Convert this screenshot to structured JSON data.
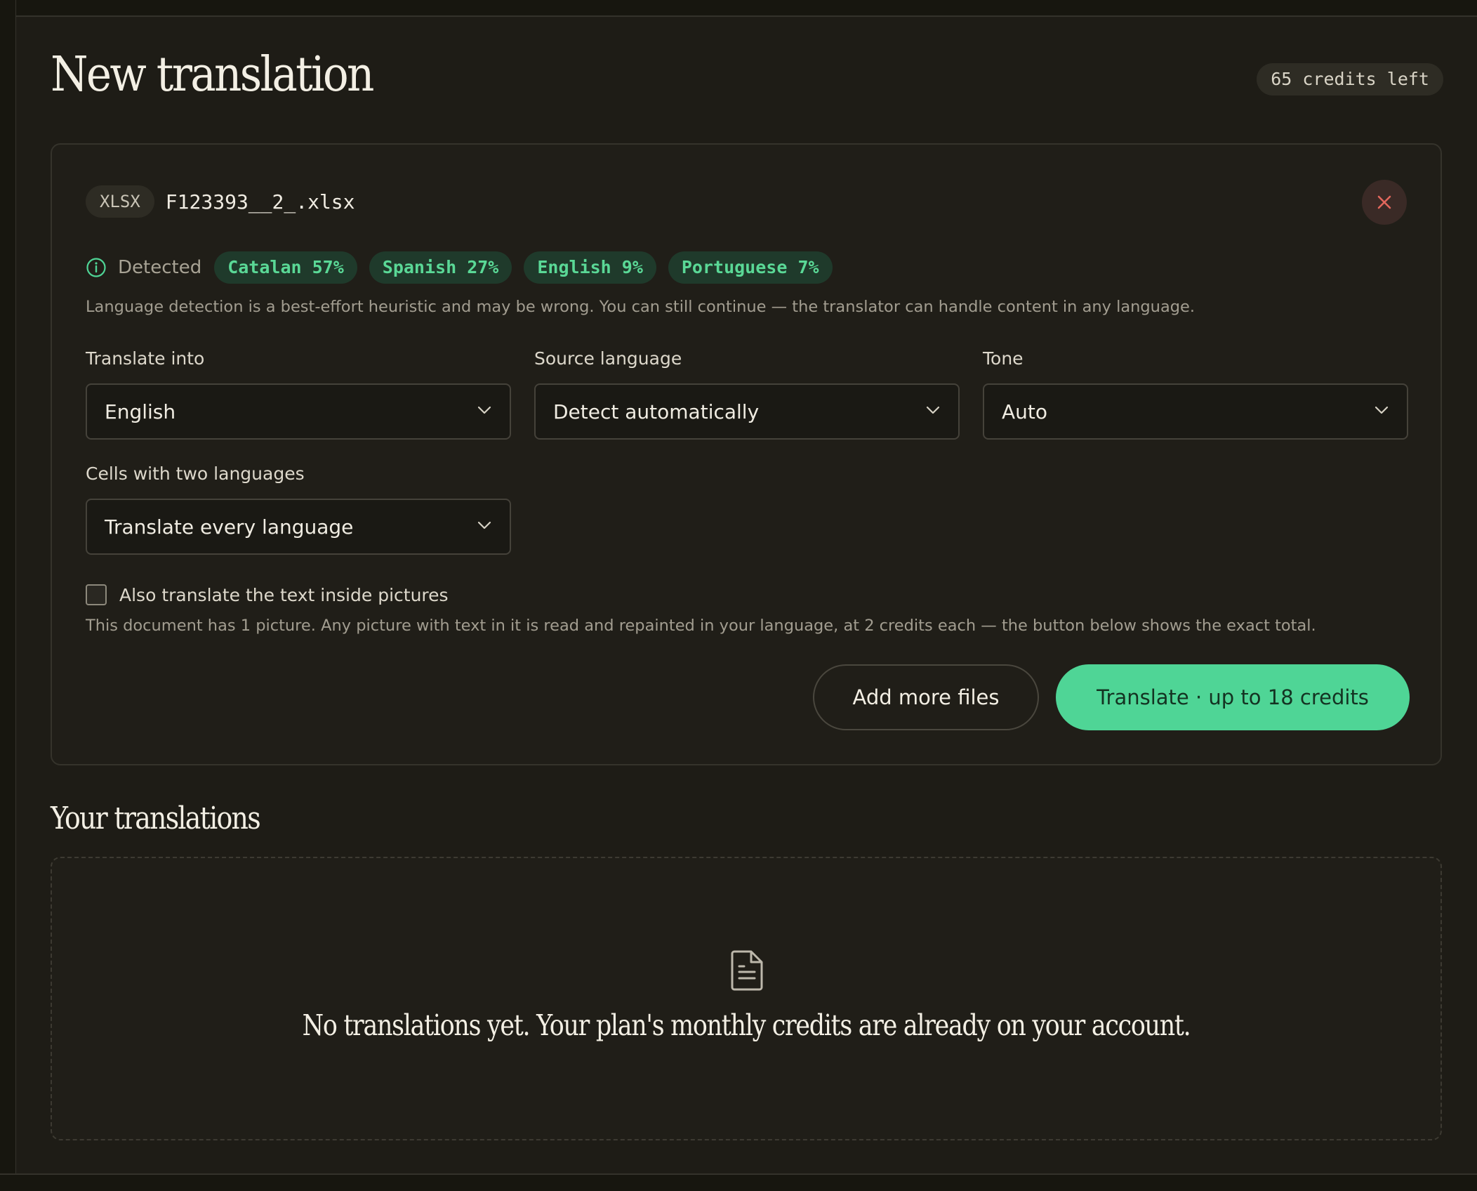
{
  "header": {
    "title": "New translation",
    "credits_left": "65 credits left"
  },
  "file": {
    "type": "XLSX",
    "name": "F123393__2_.xlsx"
  },
  "detection": {
    "label": "Detected",
    "languages": [
      {
        "label": "Catalan 57%"
      },
      {
        "label": "Spanish 27%"
      },
      {
        "label": "English 9%"
      },
      {
        "label": "Portuguese 7%"
      }
    ],
    "note": "Language detection is a best-effort heuristic and may be wrong. You can still continue — the translator can handle content in any language."
  },
  "fields": {
    "translate_into": {
      "label": "Translate into",
      "value": "English"
    },
    "source_language": {
      "label": "Source language",
      "value": "Detect automatically"
    },
    "tone": {
      "label": "Tone",
      "value": "Auto"
    },
    "two_languages": {
      "label": "Cells with two languages",
      "value": "Translate every language"
    }
  },
  "pictures": {
    "checkbox_label": "Also translate the text inside pictures",
    "checked": false,
    "note": "This document has 1 picture. Any picture with text in it is read and repainted in your language, at 2 credits each — the button below shows the exact total."
  },
  "actions": {
    "add_more": "Add more files",
    "translate": "Translate · up to 18 credits"
  },
  "history": {
    "title": "Your translations",
    "empty_text": "No translations yet. Your plan's monthly credits are already on your account."
  },
  "colors": {
    "accent": "#4fd596",
    "chip_text": "#5ad896",
    "close_icon": "#e2675c",
    "background": "#1e1c16"
  },
  "icons": {
    "info": "info-circle-icon",
    "close": "close-icon",
    "chevron": "chevron-down-icon",
    "empty": "document-icon"
  }
}
